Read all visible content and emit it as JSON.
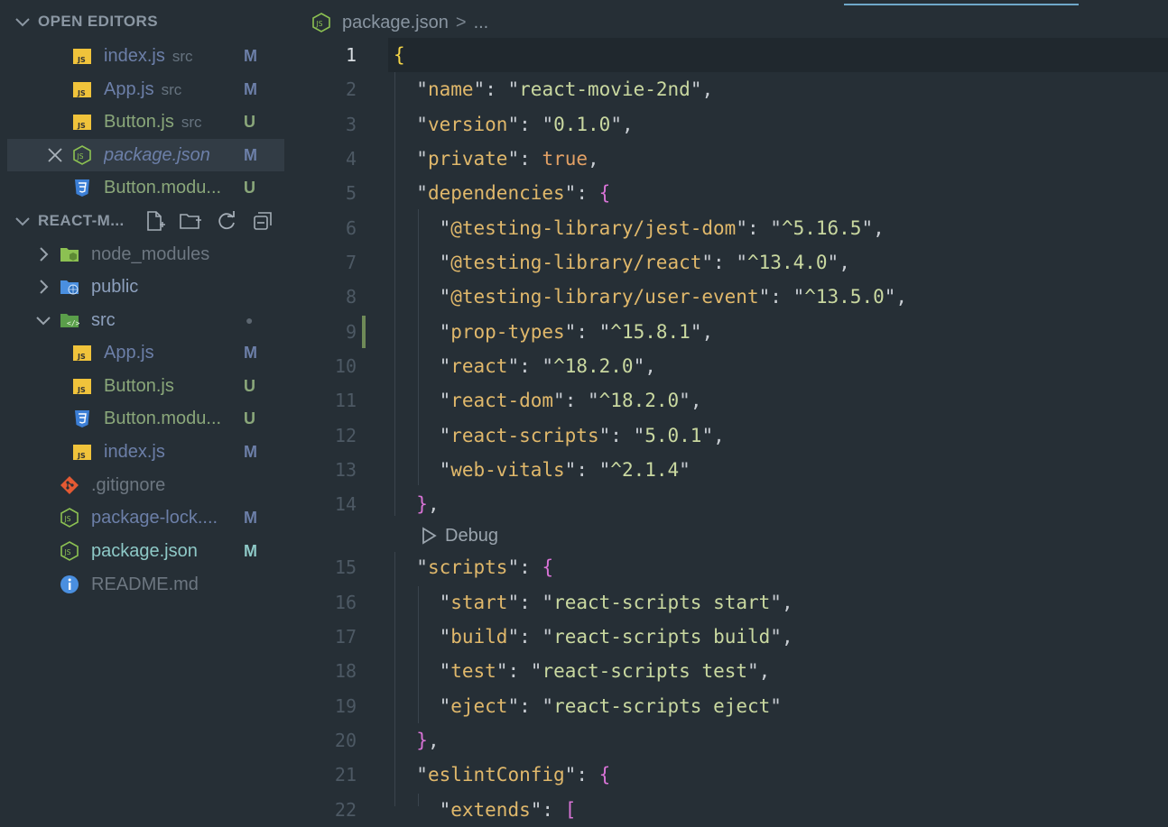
{
  "sidebar": {
    "open_editors_title": "OPEN EDITORS",
    "open_editors": [
      {
        "name": "index.js",
        "dir": "src",
        "badge": "M",
        "icon": "js-file-icon"
      },
      {
        "name": "App.js",
        "dir": "src",
        "badge": "M",
        "icon": "js-file-icon"
      },
      {
        "name": "Button.js",
        "dir": "src",
        "badge": "U",
        "icon": "js-file-icon"
      },
      {
        "name": "package.json",
        "dir": "",
        "badge": "M",
        "icon": "nodejs-file-icon"
      },
      {
        "name": "Button.modu...",
        "dir": "",
        "badge": "U",
        "icon": "css-file-icon"
      }
    ],
    "project_title": "REACT-M...",
    "tree": [
      {
        "name": "node_modules",
        "badge": "",
        "icon": "node-modules-folder-icon"
      },
      {
        "name": "public",
        "badge": "",
        "icon": "public-folder-icon"
      },
      {
        "name": "src",
        "badge": "●",
        "icon": "src-folder-icon"
      },
      {
        "name": "App.js",
        "badge": "M",
        "icon": "js-file-icon"
      },
      {
        "name": "Button.js",
        "badge": "U",
        "icon": "js-file-icon"
      },
      {
        "name": "Button.modu...",
        "badge": "U",
        "icon": "css-file-icon"
      },
      {
        "name": "index.js",
        "badge": "M",
        "icon": "js-file-icon"
      },
      {
        "name": ".gitignore",
        "badge": "",
        "icon": "git-icon"
      },
      {
        "name": "package-lock....",
        "badge": "M",
        "icon": "nodejs-file-icon"
      },
      {
        "name": "package.json",
        "badge": "M",
        "icon": "nodejs-file-icon"
      },
      {
        "name": "README.md",
        "badge": "",
        "icon": "info-icon"
      }
    ]
  },
  "editor": {
    "breadcrumb_file": "package.json",
    "breadcrumb_sep": ">",
    "breadcrumb_more": "...",
    "codelens": "Debug",
    "line_numbers": [
      "1",
      "2",
      "3",
      "4",
      "5",
      "6",
      "7",
      "8",
      "9",
      "10",
      "11",
      "12",
      "13",
      "14",
      "15",
      "16",
      "17",
      "18",
      "19",
      "20",
      "21",
      "22"
    ],
    "lines": [
      "{",
      "\"name\": \"react-movie-2nd\",",
      "\"version\": \"0.1.0\",",
      "\"private\": true,",
      "\"dependencies\": {",
      "\"@testing-library/jest-dom\": \"^5.16.5\",",
      "\"@testing-library/react\": \"^13.4.0\",",
      "\"@testing-library/user-event\": \"^13.5.0\",",
      "\"prop-types\": \"^15.8.1\",",
      "\"react\": \"^18.2.0\",",
      "\"react-dom\": \"^18.2.0\",",
      "\"react-scripts\": \"5.0.1\",",
      "\"web-vitals\": \"^2.1.4\"",
      "},",
      "\"scripts\": {",
      "\"start\": \"react-scripts start\",",
      "\"build\": \"react-scripts build\",",
      "\"test\": \"react-scripts test\",",
      "\"eject\": \"react-scripts eject\"",
      "},",
      "\"eslintConfig\": {",
      "\"extends\": ["
    ]
  }
}
